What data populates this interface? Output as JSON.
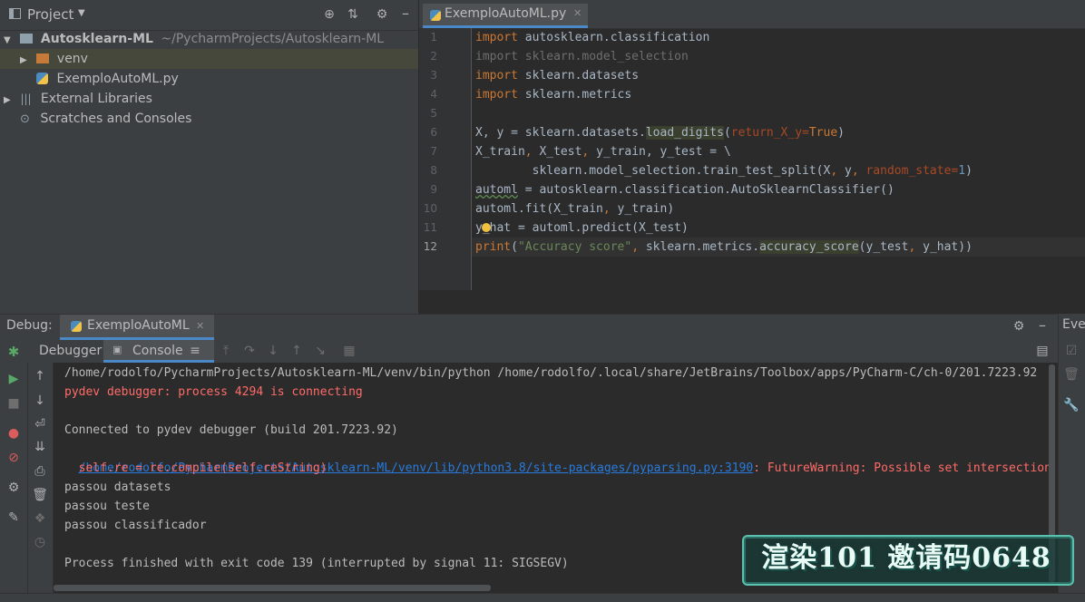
{
  "project": {
    "title": "Project",
    "root_name": "Autosklearn-ML",
    "root_path": "~/PycharmProjects/Autosklearn-ML",
    "items": [
      {
        "label": "venv"
      },
      {
        "label": "ExemploAutoML.py"
      },
      {
        "label": "External Libraries"
      },
      {
        "label": "Scratches and Consoles"
      }
    ]
  },
  "editor": {
    "tab": "ExemploAutoML.py",
    "line_numbers": [
      "1",
      "2",
      "3",
      "4",
      "5",
      "6",
      "7",
      "8",
      "9",
      "10",
      "11",
      "12"
    ]
  },
  "debug": {
    "label": "Debug:",
    "tab": "ExemploAutoML",
    "debugger_tab": "Debugger",
    "console_tab": "Console",
    "output": [
      "/home/rodolfo/PycharmProjects/Autosklearn-ML/venv/bin/python /home/rodolfo/.local/share/JetBrains/Toolbox/apps/PyCharm-C/ch-0/201.7223.92",
      "pydev debugger: process 4294 is connecting",
      "",
      "Connected to pydev debugger (build 201.7223.92)",
      "/home/rodolfo/PycharmProjects/Autosklearn-ML/venv/lib/python3.8/site-packages/pyparsing.py:3190",
      ": FutureWarning: Possible set intersection",
      "  self.re = re.compile(self.reString)",
      "passou datasets",
      "passou teste",
      "passou classificador",
      "",
      "Process finished with exit code 139 (interrupted by signal 11: SIGSEGV)"
    ]
  },
  "right_panel": {
    "label": "Eve"
  },
  "watermark": {
    "text": "渲染101 邀请码0648"
  },
  "colors": {
    "keyword": "#cc7832",
    "string": "#6a8759",
    "number": "#6897bb",
    "error": "#ff6b68",
    "link": "#287bde"
  }
}
